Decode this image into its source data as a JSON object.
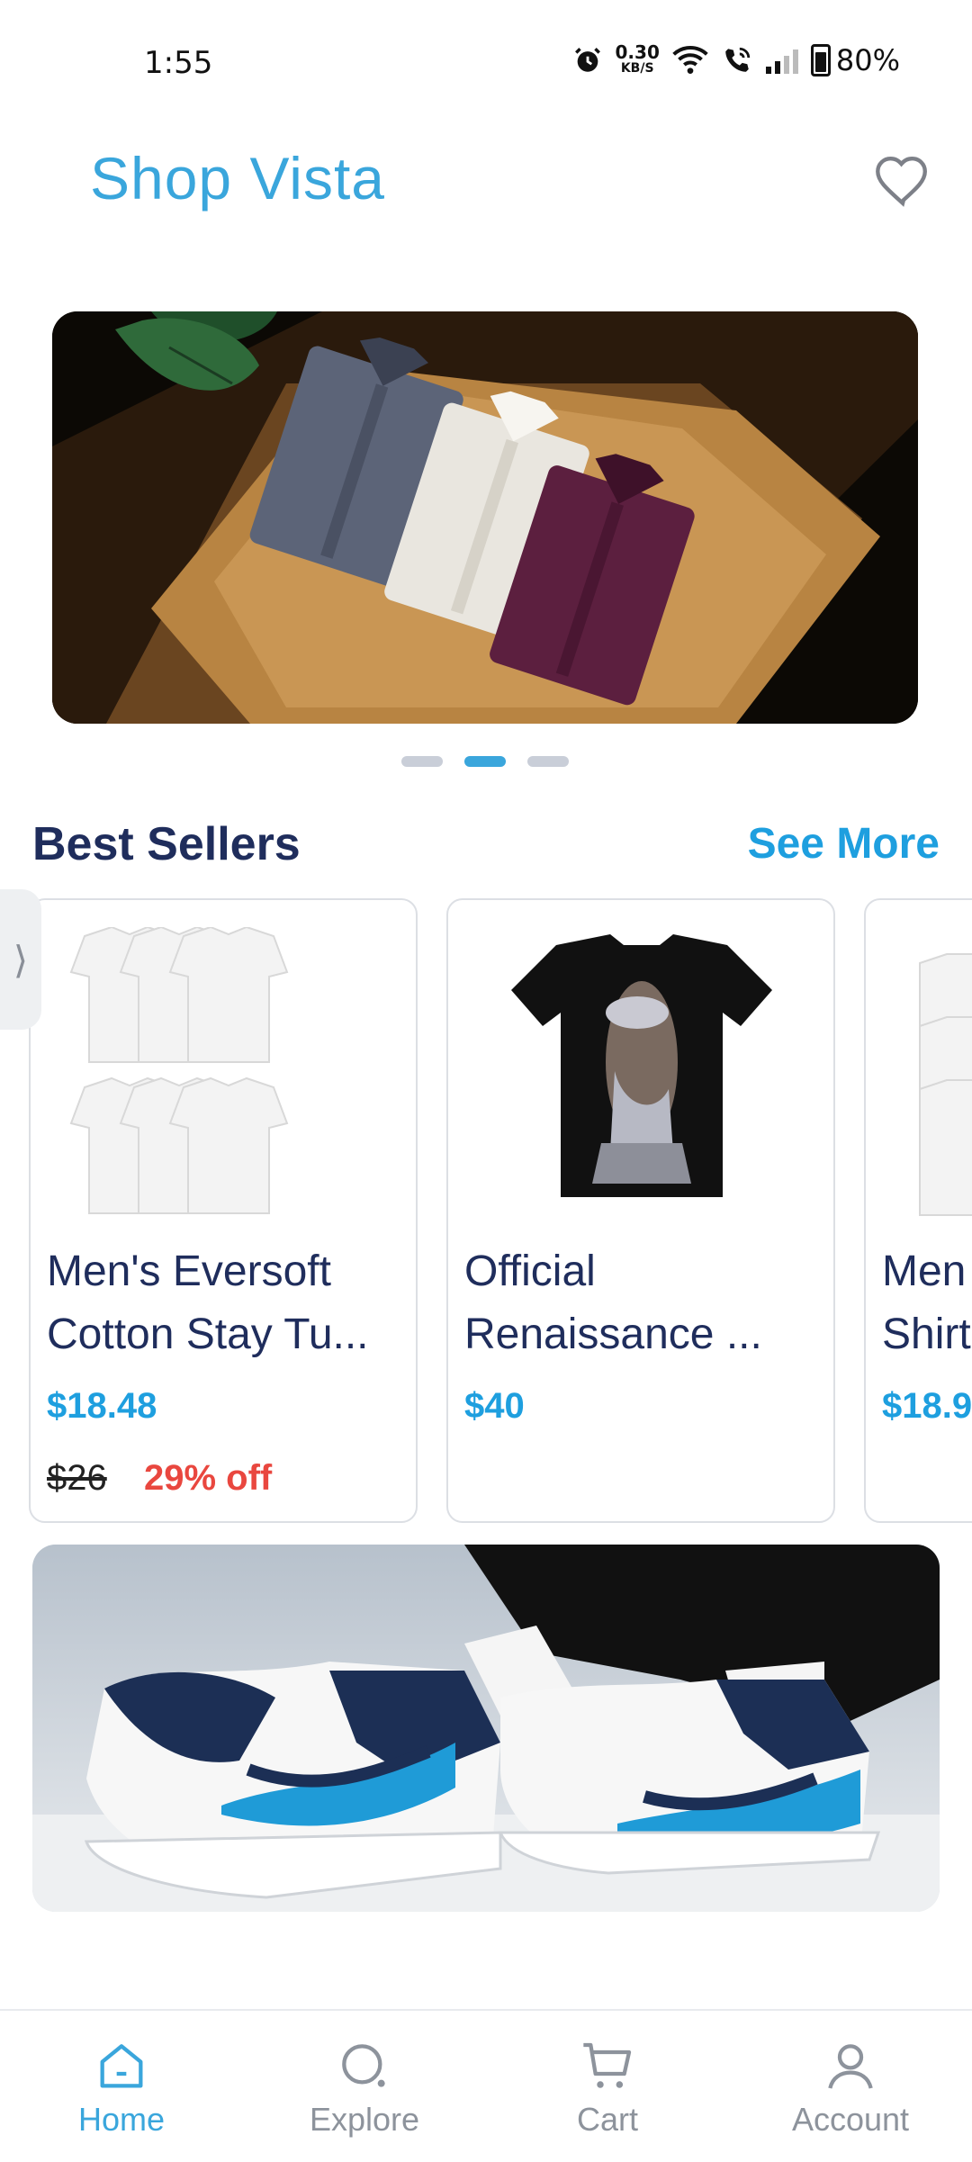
{
  "status_bar": {
    "time": "1:55",
    "net_speed_value": "0.30",
    "net_speed_unit": "KB/S",
    "battery": "80%",
    "icons": [
      "alarm-icon",
      "wifi-icon",
      "wifi-calling-icon",
      "signal-icon",
      "battery-icon"
    ]
  },
  "header": {
    "title": "Shop Vista",
    "favorite_icon": "heart-icon"
  },
  "carousel": {
    "slide_count": 3,
    "active_index": 1
  },
  "best_sellers": {
    "title": "Best Sellers",
    "see_more": "See More",
    "products": [
      {
        "name_line1": "Men's Eversoft",
        "name_line2": "Cotton Stay Tu...",
        "price": "$18.48",
        "old_price": "$26",
        "discount": "29% off"
      },
      {
        "name_line1": "Official",
        "name_line2": "Renaissance ...",
        "price": "$40"
      },
      {
        "name_line1": "Men",
        "name_line2": "Shirt",
        "price": "$18.9"
      }
    ]
  },
  "colors": {
    "accent": "#3aa6dc",
    "link": "#1e9fdf",
    "heading": "#1f2d5c",
    "discount": "#e9473f"
  },
  "bottom_nav": {
    "items": [
      {
        "label": "Home",
        "icon": "home-icon",
        "active": true
      },
      {
        "label": "Explore",
        "icon": "search-icon",
        "active": false
      },
      {
        "label": "Cart",
        "icon": "cart-icon",
        "active": false
      },
      {
        "label": "Account",
        "icon": "user-icon",
        "active": false
      }
    ]
  }
}
